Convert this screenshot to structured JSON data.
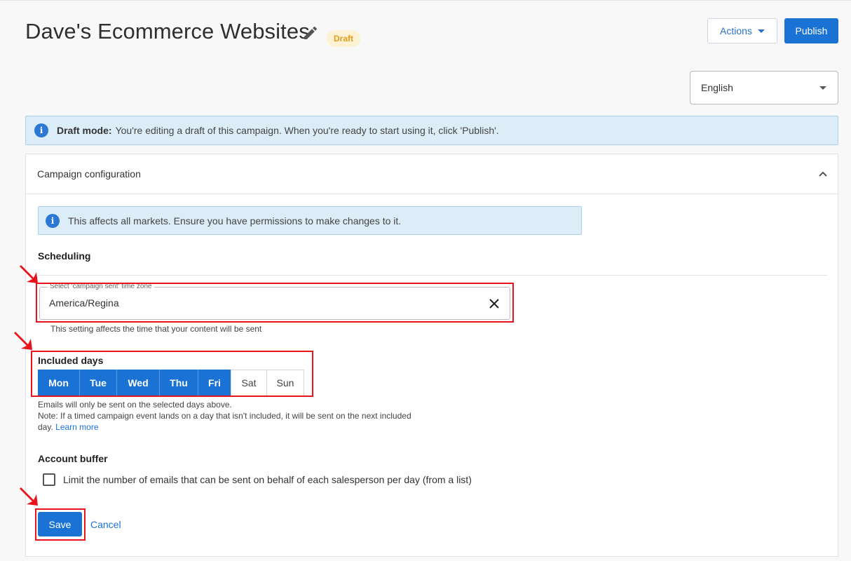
{
  "header": {
    "title": "Dave's Ecommerce Websites",
    "status_badge": "Draft",
    "actions_label": "Actions",
    "publish_label": "Publish"
  },
  "language_select": {
    "value": "English"
  },
  "draft_banner": {
    "strong": "Draft mode:",
    "text": "You're editing a draft of this campaign. When you're ready to start using it, click 'Publish'."
  },
  "panel": {
    "title": "Campaign configuration",
    "markets_notice": "This affects all markets. Ensure you have permissions to make changes to it.",
    "scheduling": {
      "title": "Scheduling",
      "timezone": {
        "label": "Select 'campaign sent' time zone",
        "value": "America/Regina",
        "helper": "This setting affects the time that your content will be sent"
      },
      "included_days": {
        "title": "Included days",
        "days": [
          {
            "label": "Mon",
            "selected": true
          },
          {
            "label": "Tue",
            "selected": true
          },
          {
            "label": "Wed",
            "selected": true
          },
          {
            "label": "Thu",
            "selected": true
          },
          {
            "label": "Fri",
            "selected": true
          },
          {
            "label": "Sat",
            "selected": false
          },
          {
            "label": "Sun",
            "selected": false
          }
        ],
        "helper_line1": "Emails will only be sent on the selected days above.",
        "helper_line2": "Note: If a timed campaign event lands on a day that isn't included, it will be sent on the next included",
        "helper_line3": "day.",
        "learn_more": "Learn more"
      }
    },
    "account_buffer": {
      "title": "Account buffer",
      "checkbox_label": "Limit the number of emails that can be sent on behalf of each salesperson per day (from a list)",
      "checked": false
    },
    "save_label": "Save",
    "cancel_label": "Cancel"
  },
  "colors": {
    "primary": "#1a73d4",
    "info_bg": "#dcedf8",
    "badge_bg": "#fdf3d4",
    "badge_text": "#e39c1a",
    "annotation": "#e8141b"
  }
}
